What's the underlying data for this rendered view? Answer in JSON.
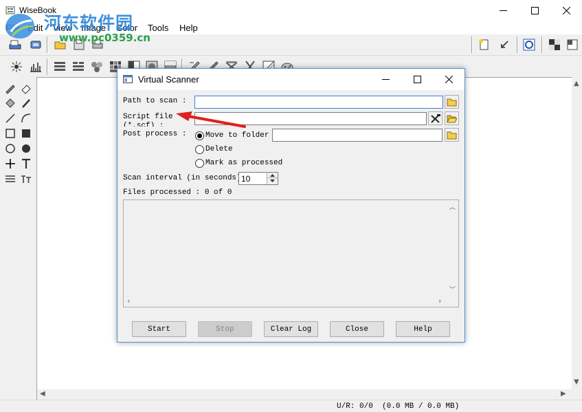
{
  "app": {
    "title": "WiseBook",
    "watermark_name": "河东软件园",
    "watermark_url": "www.pc0359.cn"
  },
  "menu": {
    "items": [
      "File",
      "Edit",
      "View",
      "Image",
      "Color",
      "Tools",
      "Help"
    ]
  },
  "status": {
    "text": "U/R: 0/0  (0.0 MB / 0.0 MB)"
  },
  "dialog": {
    "title": "Virtual Scanner",
    "path_label": "Path to scan :",
    "path_value": "",
    "script_label": "Script file\n(*.scf) :",
    "script_value": "",
    "post_label": "Post process :",
    "options": {
      "move": "Move to folder",
      "delete": "Delete",
      "mark": "Mark as processed",
      "selected": "move"
    },
    "move_folder_value": "",
    "interval_label": "Scan interval (in seconds) :",
    "interval_value": "10",
    "files_processed": "Files processed : 0 of 0",
    "log_text": "",
    "buttons": {
      "start": "Start",
      "stop": "Stop",
      "clear_log": "Clear Log",
      "close": "Close",
      "help": "Help"
    }
  },
  "colors": {
    "annotation_arrow": "#e02020",
    "dialog_border": "#4a90d9",
    "field_focus": "#3c7fd1"
  }
}
